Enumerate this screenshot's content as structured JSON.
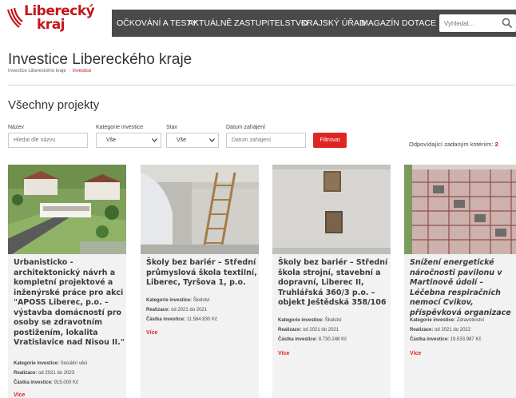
{
  "brand": {
    "line1": "Liberecký",
    "line2": "kraj",
    "color": "#c4161c"
  },
  "nav": {
    "items": [
      "OČKOVÁNÍ A TESTY",
      "AKTUÁLNĚ",
      "ZASTUPITELSTVO",
      "KRAJSKÝ ÚŘAD",
      "MAGAZÍN",
      "DOTACE"
    ],
    "search_placeholder": "Vyhledat..."
  },
  "page": {
    "title": "Investice Libereckého kraje",
    "breadcrumb": [
      "Investice Libereckého kraje",
      "Investice"
    ],
    "section_title": "Všechny projekty"
  },
  "filters": {
    "name_label": "Název",
    "name_placeholder": "Hledat dle názvu",
    "category_label": "Kategorie investice",
    "category_value": "Vše",
    "status_label": "Stav",
    "status_value": "Vše",
    "start_label": "Datum zahájení",
    "start_placeholder": "Datum zahájení",
    "button": "Filtrovat",
    "results_label": "Odpovídající zadaným kritériím:",
    "results_count": "2"
  },
  "labels": {
    "category": "Kategorie investice:",
    "realization": "Realizace:",
    "amount": "Částka investice:",
    "more": "Více"
  },
  "cards": [
    {
      "title": "Urbanisticko - architektonický návrh a kompletní projektové a inženýrské práce pro akci \"APOSS Liberec, p.o. – výstavba domácností pro osoby se zdravotním postižením, lokalita Vratislavice nad Nisou II.\"",
      "category": "Sociální věci",
      "realization": "od 2021 do 2023",
      "amount": "915.000 Kč"
    },
    {
      "title": "Školy bez bariér – Střední průmyslová škola textilní, Liberec, Tyršova 1, p.o.",
      "category": "Školství",
      "realization": "od 2021 do 2021",
      "amount": "11.584.830 Kč"
    },
    {
      "title": "Školy bez bariér – Střední škola strojní, stavební a dopravní, Liberec II, Truhlářská 360/3 p.o. – objekt Ještědská 358/106",
      "category": "Školství",
      "realization": "od 2021 do 2021",
      "amount": "8.730.248 Kč"
    },
    {
      "title": "Snížení energetické náročnosti pavilonu v Martinově údolí – Léčebna respiračních nemocí Cvikov, příspěvková organizace",
      "category": "Zdravotnictví",
      "realization": "od 2021 do 2022",
      "amount": "19.533.987 Kč"
    }
  ],
  "colors": {
    "nav_bg": "#4a4a4a",
    "accent": "#e02424",
    "card_bg": "#f2f2f2"
  }
}
